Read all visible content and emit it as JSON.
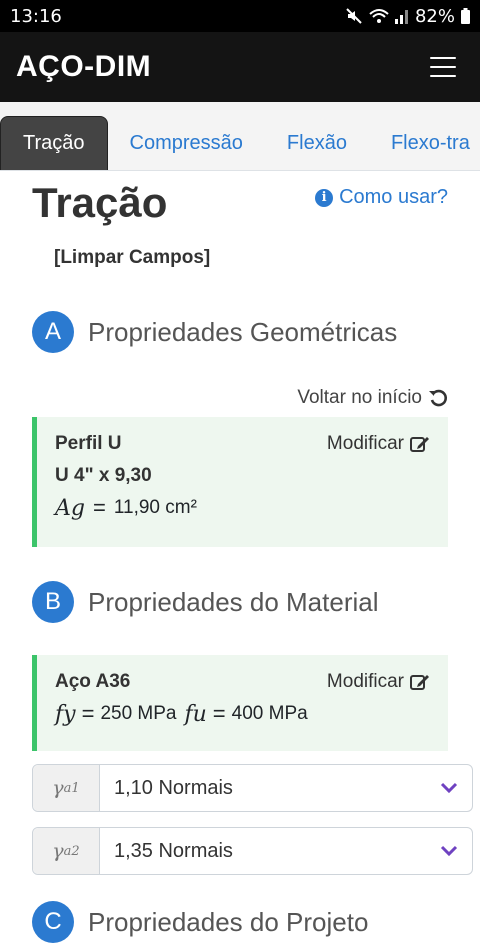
{
  "status_bar": {
    "time": "13:16",
    "battery": "82%"
  },
  "app": {
    "title": "AÇO-DIM"
  },
  "tabs": [
    {
      "label": "Tração",
      "active": true
    },
    {
      "label": "Compressão",
      "active": false
    },
    {
      "label": "Flexão",
      "active": false
    },
    {
      "label": "Flexo-tra",
      "active": false
    }
  ],
  "page": {
    "title": "Tração",
    "how_to": "Como usar?",
    "clear": "[Limpar Campos]"
  },
  "section_a": {
    "badge": "A",
    "title": "Propriedades Geométricas",
    "restart": "Voltar no início",
    "card": {
      "profile_type": "Perfil U",
      "profile": "U 4\" x 9,30",
      "area_symbol": "Ag",
      "area_value": "11,90 cm²",
      "modify": "Modificar"
    }
  },
  "section_b": {
    "badge": "B",
    "title": "Propriedades do Material",
    "card": {
      "steel": "Aço A36",
      "fy_symbol": "fy",
      "fy_value": "250 MPa",
      "fu_symbol": "fu",
      "fu_value": "400 MPa",
      "modify": "Modificar"
    },
    "select1": {
      "symbol": "γ",
      "sub": "a1",
      "value": "1,10 Normais"
    },
    "select2": {
      "symbol": "γ",
      "sub": "a2",
      "value": "1,35 Normais"
    }
  },
  "section_c": {
    "badge": "C",
    "title": "Propriedades do Projeto"
  },
  "colors": {
    "accent": "#2b7ad0",
    "success": "#3cc46a",
    "card_bg": "#eef7ef",
    "navbar": "#141414"
  },
  "icons": [
    "mute-icon",
    "wifi-icon",
    "signal-icon",
    "battery-icon",
    "menu-icon",
    "info-icon",
    "restart-icon",
    "edit-icon",
    "chevron-down-icon"
  ]
}
